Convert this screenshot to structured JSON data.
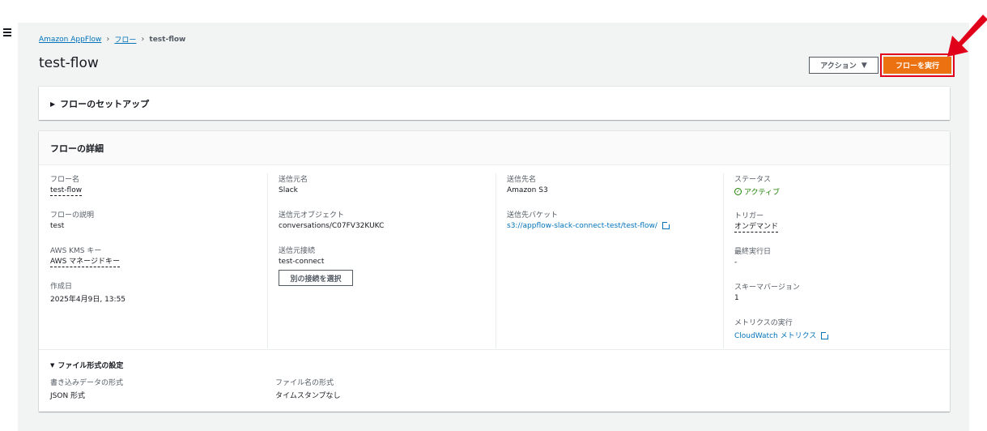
{
  "breadcrumb": {
    "root": "Amazon AppFlow",
    "flows": "フロー",
    "current": "test-flow"
  },
  "page": {
    "title": "test-flow"
  },
  "toolbar": {
    "actions_label": "アクション",
    "run_label": "フローを実行"
  },
  "setup": {
    "title": "フローのセットアップ"
  },
  "details": {
    "title": "フローの詳細",
    "flow_name_label": "フロー名",
    "flow_name_value": "test-flow",
    "description_label": "フローの説明",
    "description_value": "test",
    "kms_label": "AWS KMS キー",
    "kms_value": "AWS マネージドキー",
    "created_label": "作成日",
    "created_value": "2025年4月9日, 13:55",
    "source_label": "送信元名",
    "source_value": "Slack",
    "source_object_label": "送信元オブジェクト",
    "source_object_value": "conversations/C07FV32KUKC",
    "source_conn_label": "送信元接続",
    "source_conn_value": "test-connect",
    "select_conn_button": "別の接続を選択",
    "dest_label": "送信先名",
    "dest_value": "Amazon S3",
    "bucket_label": "送信先バケット",
    "bucket_value": "s3://appflow-slack-connect-test/test-flow/",
    "status_label": "ステータス",
    "status_value": "アクティブ",
    "trigger_label": "トリガー",
    "trigger_value": "オンデマンド",
    "last_run_label": "最終実行日",
    "last_run_value": "-",
    "schema_label": "スキーマバージョン",
    "schema_value": "1",
    "metrics_label": "メトリクスの実行",
    "metrics_value": "CloudWatch メトリクス"
  },
  "file_format": {
    "title": "ファイル形式の設定",
    "write_label": "書き込みデータの形式",
    "write_value": "JSON 形式",
    "filename_label": "ファイル名の形式",
    "filename_value": "タイムスタンプなし"
  },
  "colors": {
    "accent": "#ec7211",
    "link": "#0073bb",
    "success": "#1d8102",
    "highlight": "#e1001a"
  },
  "icons": {
    "menu": "hamburger-icon",
    "chevron": "chevron-right-icon",
    "caret": "caret-down-icon",
    "external": "external-link-icon",
    "status": "check-circle-icon",
    "arrow": "red-arrow-annotation"
  }
}
